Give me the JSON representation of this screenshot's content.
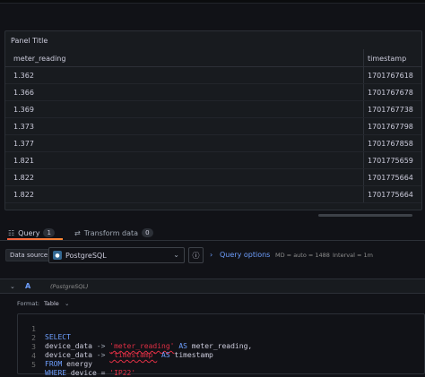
{
  "panel": {
    "title": "Panel Title",
    "columns": [
      "meter_reading",
      "timestamp"
    ],
    "rows": [
      [
        "1.362",
        "1701767618"
      ],
      [
        "1.366",
        "1701767678"
      ],
      [
        "1.369",
        "1701767738"
      ],
      [
        "1.373",
        "1701767798"
      ],
      [
        "1.377",
        "1701767858"
      ],
      [
        "1.821",
        "1701775659"
      ],
      [
        "1.822",
        "1701775664"
      ],
      [
        "1.822",
        "1701775664"
      ]
    ]
  },
  "tabs": {
    "query_label": "Query",
    "query_count": "1",
    "transform_label": "Transform data",
    "transform_count": "0"
  },
  "datasource": {
    "label": "Data source",
    "selected": "PostgreSQL",
    "query_options_label": "Query options",
    "md_info": "MD = auto = 1488",
    "interval_info": "Interval = 1m"
  },
  "query": {
    "name": "A",
    "datasource_hint": "(PostgreSQL)",
    "format_label": "Format:",
    "format_value": "Table",
    "lines": [
      {
        "num": "1",
        "kw": "SELECT",
        "rest": ""
      },
      {
        "num": "2",
        "ident": "device_data",
        "op": " -> ",
        "str": "'meter_reading'",
        "kw": " AS ",
        "rest": "meter_reading,"
      },
      {
        "num": "3",
        "ident": "device_data",
        "op": " -> ",
        "str": "'timestamp'",
        "kw": " AS ",
        "rest": "timestamp"
      },
      {
        "num": "4",
        "kw": "FROM",
        "rest": " energy"
      },
      {
        "num": "5",
        "kw": "WHERE",
        "rest": " device = ",
        "str": "'IP22'"
      }
    ]
  },
  "colors": {
    "background": "#111217",
    "panel": "#181b1f",
    "accent_blue": "#6e9fff",
    "accent_orange": "#f55f3e",
    "string_red": "#e02f44"
  }
}
